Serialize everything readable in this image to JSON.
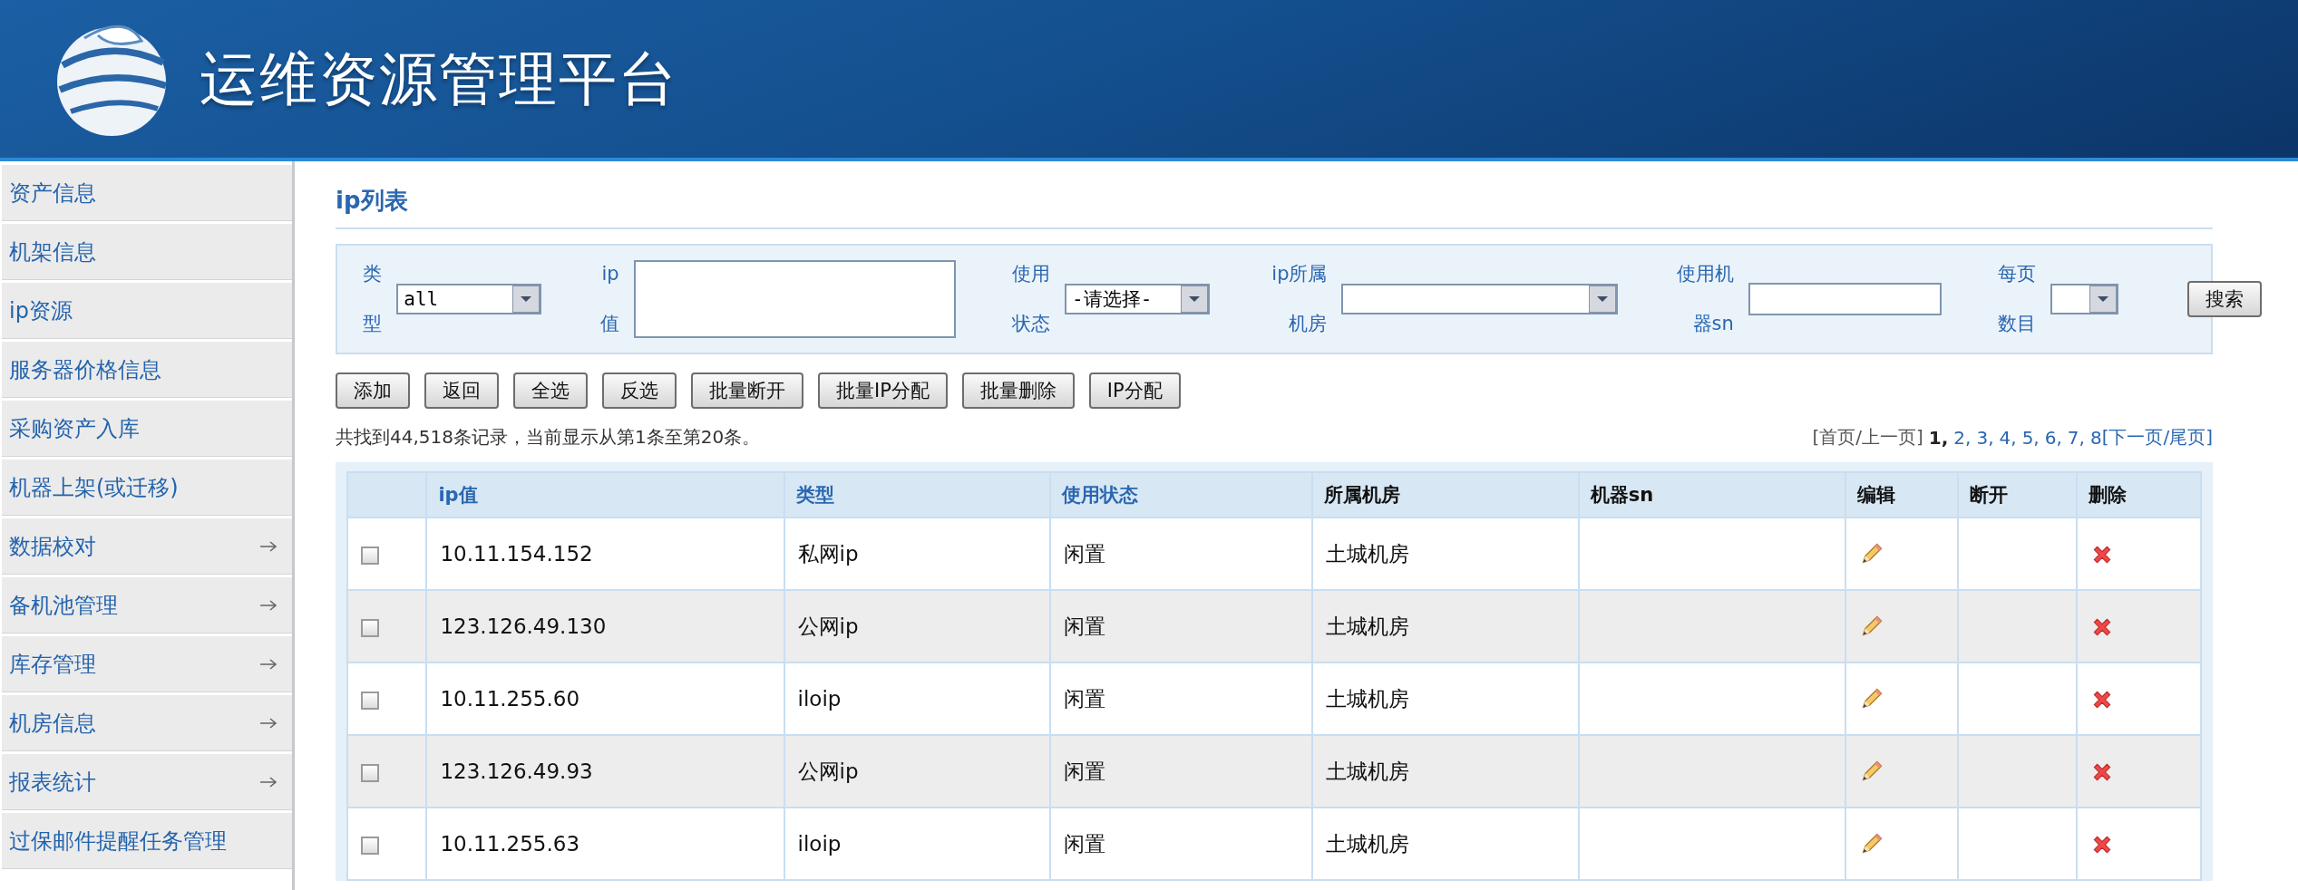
{
  "header": {
    "title": "运维资源管理平台"
  },
  "sidebar": {
    "items": [
      {
        "label": "资产信息",
        "has_submenu": false
      },
      {
        "label": "机架信息",
        "has_submenu": false
      },
      {
        "label": "ip资源",
        "has_submenu": false
      },
      {
        "label": "服务器价格信息",
        "has_submenu": false
      },
      {
        "label": "采购资产入库",
        "has_submenu": false
      },
      {
        "label": "机器上架(或迁移)",
        "has_submenu": false
      },
      {
        "label": "数据校对",
        "has_submenu": true
      },
      {
        "label": "备机池管理",
        "has_submenu": true
      },
      {
        "label": "库存管理",
        "has_submenu": true
      },
      {
        "label": "机房信息",
        "has_submenu": true
      },
      {
        "label": "报表统计",
        "has_submenu": true
      },
      {
        "label": "过保邮件提醒任务管理",
        "has_submenu": false
      }
    ]
  },
  "page_title": "ip列表",
  "filters": [
    {
      "kind": "select",
      "label": "类型",
      "value": "all"
    },
    {
      "kind": "textarea",
      "label": "ip值"
    },
    {
      "kind": "select",
      "label": "使用状态",
      "value": "-请选择-"
    },
    {
      "kind": "select",
      "label": "ip所属机房"
    },
    {
      "kind": "input",
      "label": "使用机器sn"
    },
    {
      "kind": "select",
      "label": "每页数目"
    }
  ],
  "search_button": "搜索",
  "actions": [
    "添加",
    "返回",
    "全选",
    "反选",
    "批量断开",
    "批量IP分配",
    "批量删除",
    "IP分配"
  ],
  "summary": "共找到44,518条记录，当前显示从第1条至第20条。",
  "pagination": {
    "first_prev": "[首页/上一页]",
    "pages": [
      {
        "label": "1,",
        "selected": true
      },
      {
        "label": "2,",
        "selected": false
      },
      {
        "label": "3,",
        "selected": false
      },
      {
        "label": "4,",
        "selected": false
      },
      {
        "label": "5,",
        "selected": false
      },
      {
        "label": "6,",
        "selected": false
      },
      {
        "label": "7,",
        "selected": false
      },
      {
        "label": "8",
        "selected": false
      }
    ],
    "next_last": "[下一页/尾页]"
  },
  "table": {
    "columns": [
      {
        "label": "ip值",
        "sortable": true
      },
      {
        "label": "类型",
        "sortable": true
      },
      {
        "label": "使用状态",
        "sortable": true
      },
      {
        "label": "所属机房",
        "sortable": false
      },
      {
        "label": "机器sn",
        "sortable": false
      },
      {
        "label": "编辑",
        "sortable": false
      },
      {
        "label": "断开",
        "sortable": false
      },
      {
        "label": "删除",
        "sortable": false
      }
    ],
    "rows": [
      {
        "checked": false,
        "ip": "10.11.154.152",
        "type": "私网ip",
        "status": "闲置",
        "room": "土城机房"
      },
      {
        "checked": false,
        "ip": "123.126.49.130",
        "type": "公网ip",
        "status": "闲置",
        "room": "土城机房"
      },
      {
        "checked": false,
        "ip": "10.11.255.60",
        "type": "iloip",
        "status": "闲置",
        "room": "土城机房"
      },
      {
        "checked": false,
        "ip": "123.126.49.93",
        "type": "公网ip",
        "status": "闲置",
        "room": "土城机房"
      },
      {
        "checked": false,
        "ip": "10.11.255.63",
        "type": "iloip",
        "status": "闲置",
        "room": "土城机房"
      }
    ]
  }
}
